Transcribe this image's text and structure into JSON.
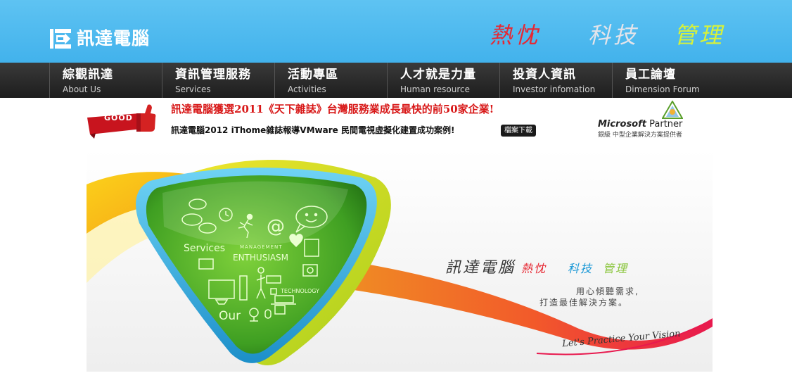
{
  "header": {
    "logo_text": "訊達電腦",
    "slogans": [
      "熱忱",
      "科技",
      "管理"
    ]
  },
  "nav": {
    "items": [
      {
        "zh": "綜觀訊達",
        "en": "About Us"
      },
      {
        "zh": "資訊管理服務",
        "en": "Services"
      },
      {
        "zh": "活動專區",
        "en": "Activities"
      },
      {
        "zh": "人才就是力量",
        "en": "Human resource"
      },
      {
        "zh": "投資人資訊",
        "en": "Investor infomation"
      },
      {
        "zh": "員工論壇",
        "en": "Dimension Forum"
      }
    ]
  },
  "news": {
    "badge": "GOOD",
    "headline": "訊達電腦獲選2011《天下雜誌》台灣服務業成長最快的前50家企業!",
    "subline": "訊達電腦2012 iThome雜誌報導VMware 民間電視虛擬化建置成功案例!",
    "download_label": "檔案下載"
  },
  "partner": {
    "brand": "Microsoft",
    "label": "Partner",
    "sub": "銀級 中型企業解決方案提供者"
  },
  "banner": {
    "company": "訊達電腦",
    "slogans": [
      "熱忱",
      "科技",
      "管理"
    ],
    "line1": "用心傾聽需求,",
    "line2": "打造最佳解決方案。",
    "tagline": "Let's Practice Your Vision",
    "triangle_labels": {
      "services": "Services",
      "management": "MANAGEMENT",
      "enthusiasm": "ENTHUSIASM",
      "technology": "TECHNOLOGY",
      "our": "Our"
    }
  },
  "colors": {
    "header_blue": "#42b2ec",
    "nav_dark": "#1d1d1d",
    "headline_red": "#d81818",
    "slogan_red": "#e62833",
    "slogan_lime": "#d7f23a",
    "triangle_green": "#4dae2c"
  }
}
